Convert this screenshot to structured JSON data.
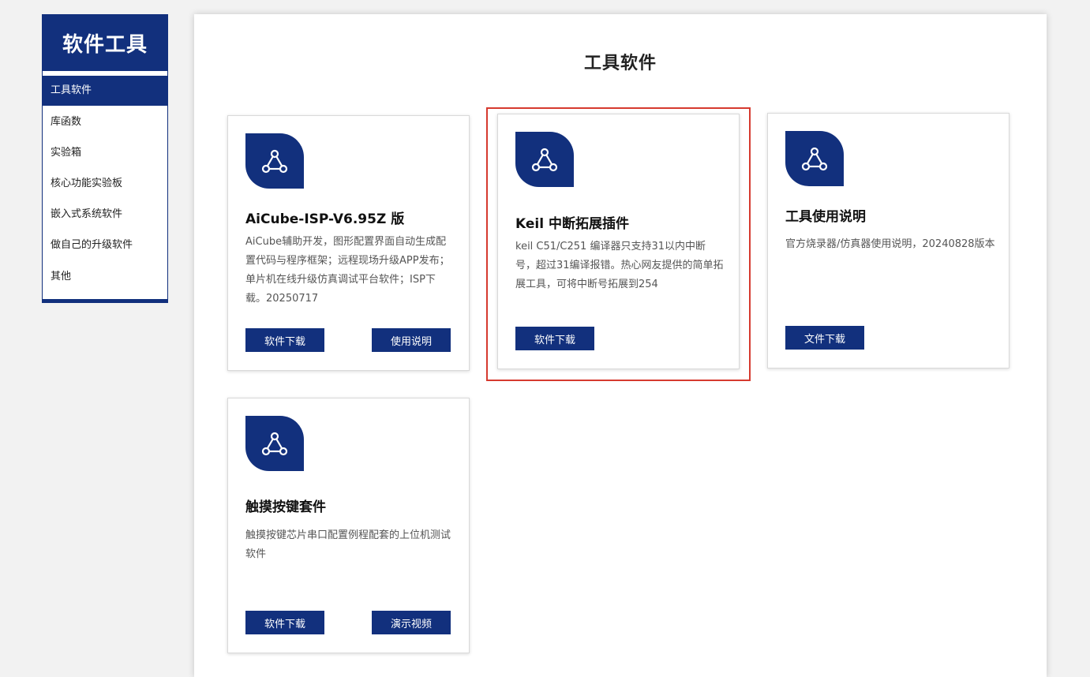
{
  "sidebar": {
    "title": "软件工具",
    "items": [
      {
        "label": "工具软件",
        "active": true
      },
      {
        "label": "库函数",
        "active": false
      },
      {
        "label": "实验箱",
        "active": false
      },
      {
        "label": "核心功能实验板",
        "active": false
      },
      {
        "label": "嵌入式系统软件",
        "active": false
      },
      {
        "label": "做自己的升级软件",
        "active": false
      },
      {
        "label": "其他",
        "active": false
      }
    ]
  },
  "main": {
    "title": "工具软件",
    "cards": [
      {
        "icon": "webhook-icon",
        "title": "AiCube-ISP-V6.95Z 版",
        "desc": "AiCube辅助开发，图形配置界面自动生成配置代码与程序框架；远程现场升级APP发布；单片机在线升级仿真调试平台软件；ISP下载。20250717",
        "buttons": [
          "软件下载",
          "使用说明"
        ]
      },
      {
        "icon": "webhook-icon",
        "title": "Keil 中断拓展插件",
        "desc": "keil C51/C251 编译器只支持31以内中断号，超过31编译报错。热心网友提供的简单拓展工具，可将中断号拓展到254",
        "buttons": [
          "软件下载"
        ]
      },
      {
        "icon": "webhook-icon",
        "title": "工具使用说明",
        "desc": "官方烧录器/仿真器使用说明，20240828版本",
        "buttons": [
          "文件下载"
        ]
      },
      {
        "icon": "webhook-icon",
        "title": "触摸按键套件",
        "desc": "触摸按键芯片串口配置例程配套的上位机测试软件",
        "buttons": [
          "软件下载",
          "演示视频"
        ]
      }
    ]
  },
  "colors": {
    "brand": "#12307d",
    "highlight": "#d63a2f"
  }
}
